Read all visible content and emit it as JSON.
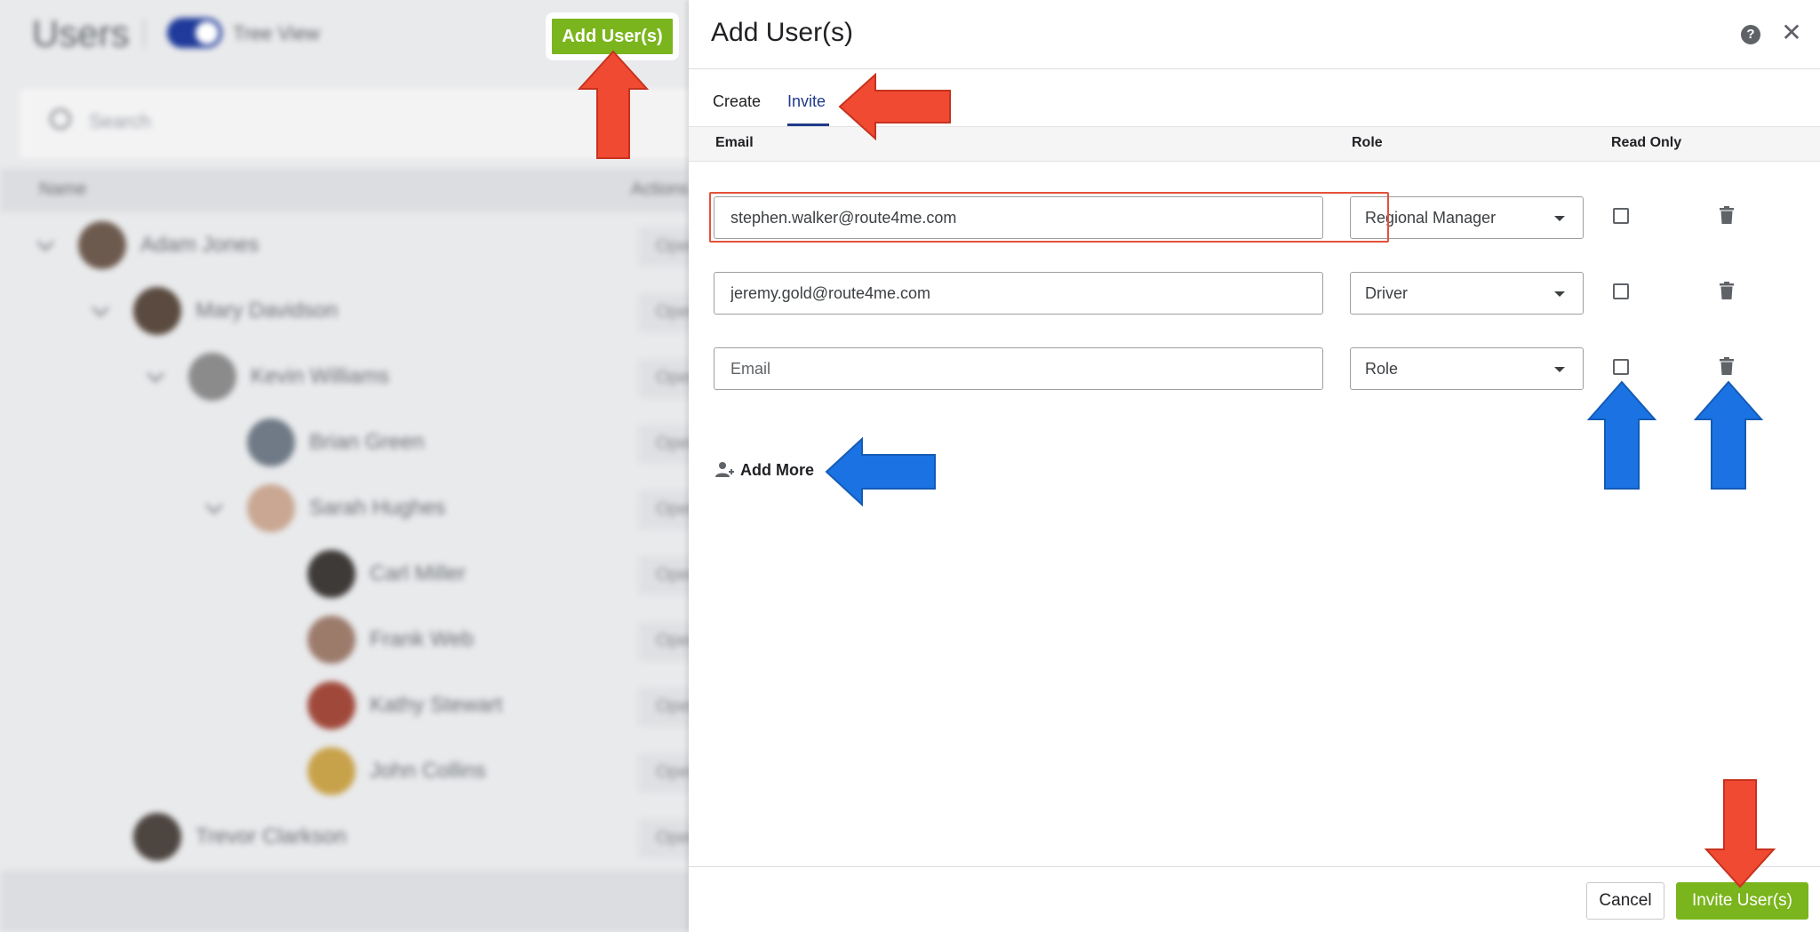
{
  "background": {
    "title": "Users",
    "tree_view_label": "Tree View",
    "search_placeholder": "Search",
    "columns": {
      "name": "Name",
      "actions": "Actions"
    },
    "rows": [
      {
        "name": "Adam Jones",
        "action": "Open"
      },
      {
        "name": "Mary Davidson",
        "action": "Open"
      },
      {
        "name": "Kevin Williams",
        "action": "Open"
      },
      {
        "name": "Brian Green",
        "action": "Open"
      },
      {
        "name": "Sarah Hughes",
        "action": "Open"
      },
      {
        "name": "Carl Miller",
        "action": "Open"
      },
      {
        "name": "Frank Web",
        "action": "Open"
      },
      {
        "name": "Kathy Stewart",
        "action": "Open"
      },
      {
        "name": "John Collins",
        "action": "Open"
      },
      {
        "name": "Trevor Clarkson",
        "action": "Open"
      }
    ],
    "add_users_button": "Add User(s)"
  },
  "panel": {
    "title": "Add User(s)",
    "tabs": [
      {
        "label": "Create",
        "active": false
      },
      {
        "label": "Invite",
        "active": true
      }
    ],
    "columns": {
      "email": "Email",
      "role": "Role",
      "read_only": "Read Only"
    },
    "rows": [
      {
        "email": "stephen.walker@route4me.com",
        "email_placeholder": "Email",
        "role": "Regional Manager",
        "read_only": false
      },
      {
        "email": "jeremy.gold@route4me.com",
        "email_placeholder": "Email",
        "role": "Driver",
        "read_only": false
      },
      {
        "email": "",
        "email_placeholder": "Email",
        "role": "Role",
        "read_only": false
      }
    ],
    "add_more_label": "Add More",
    "cancel_label": "Cancel",
    "invite_label": "Invite User(s)"
  },
  "colors": {
    "accent_green": "#7ab51d",
    "tab_active": "#1f3a8a",
    "arrow_red": "#f04a32",
    "arrow_blue": "#1b73e3",
    "highlight_red": "#e4513a"
  }
}
